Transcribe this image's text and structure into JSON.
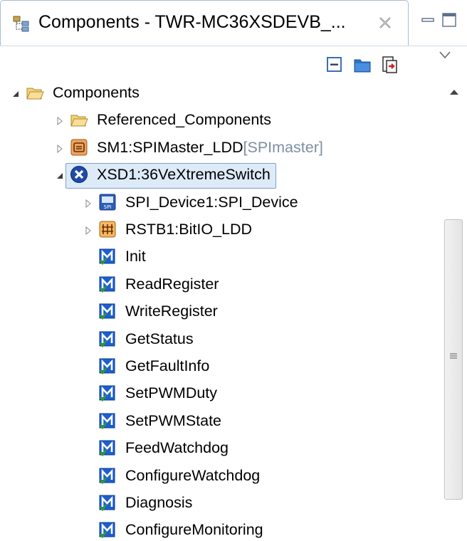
{
  "window": {
    "tab_title": "Components - TWR-MC36XSDEVB_...",
    "tab_icon": "component-tree-icon",
    "close_icon": "close-x-icon"
  },
  "window_controls": {
    "minimize_icon": "minimize-icon",
    "maximize_icon": "maximize-icon"
  },
  "toolbar": {
    "buttons": [
      {
        "icon": "collapse-all-icon"
      },
      {
        "icon": "folder-icon"
      },
      {
        "icon": "export-icon"
      }
    ],
    "view_menu_icon": "view-menu-chevron-icon"
  },
  "tree": {
    "items": [
      {
        "label": "Components",
        "suffix": "",
        "icon": "open-folder-icon",
        "expander": "expanded",
        "level": 0
      },
      {
        "label": "Referenced_Components",
        "suffix": "",
        "icon": "open-folder-icon",
        "expander": "collapsed",
        "level": 1
      },
      {
        "label": "SM1:SPIMaster_LDD",
        "suffix": "[SPImaster]",
        "icon": "spi-master-component-icon",
        "expander": "collapsed",
        "level": 1
      },
      {
        "label": "XSD1:36VeXtremeSwitch",
        "suffix": "",
        "icon": "extreme-switch-component-icon",
        "expander": "expanded",
        "level": 1,
        "selected": true
      },
      {
        "label": "SPI_Device1:SPI_Device",
        "suffix": "",
        "icon": "spi-device-component-icon",
        "expander": "collapsed",
        "level": 2
      },
      {
        "label": "RSTB1:BitIO_LDD",
        "suffix": "",
        "icon": "bitio-component-icon",
        "expander": "collapsed",
        "level": 2
      },
      {
        "label": "Init",
        "suffix": "",
        "icon": "method-icon",
        "expander": "none",
        "level": 2
      },
      {
        "label": "ReadRegister",
        "suffix": "",
        "icon": "method-icon",
        "expander": "none",
        "level": 2
      },
      {
        "label": "WriteRegister",
        "suffix": "",
        "icon": "method-icon",
        "expander": "none",
        "level": 2
      },
      {
        "label": "GetStatus",
        "suffix": "",
        "icon": "method-icon",
        "expander": "none",
        "level": 2
      },
      {
        "label": "GetFaultInfo",
        "suffix": "",
        "icon": "method-icon",
        "expander": "none",
        "level": 2
      },
      {
        "label": "SetPWMDuty",
        "suffix": "",
        "icon": "method-icon",
        "expander": "none",
        "level": 2
      },
      {
        "label": "SetPWMState",
        "suffix": "",
        "icon": "method-icon",
        "expander": "none",
        "level": 2
      },
      {
        "label": "FeedWatchdog",
        "suffix": "",
        "icon": "method-icon",
        "expander": "none",
        "level": 2
      },
      {
        "label": "ConfigureWatchdog",
        "suffix": "",
        "icon": "method-icon",
        "expander": "none",
        "level": 2
      },
      {
        "label": "Diagnosis",
        "suffix": "",
        "icon": "method-icon",
        "expander": "none",
        "level": 2
      },
      {
        "label": "ConfigureMonitoring",
        "suffix": "",
        "icon": "method-icon",
        "expander": "none",
        "level": 2
      }
    ]
  },
  "scrollbar": {
    "up_icon": "scroll-up-arrow-icon",
    "grip_icon": "scroll-grip-icon"
  },
  "colors": {
    "selection_fill": "#ddeaf7",
    "selection_border": "#7da2ce",
    "suffix_text": "#7d8fa3",
    "folder_yellow": "#f5c65a",
    "method_blue": "#1d5fd0",
    "method_check": "#2f9b2f"
  }
}
